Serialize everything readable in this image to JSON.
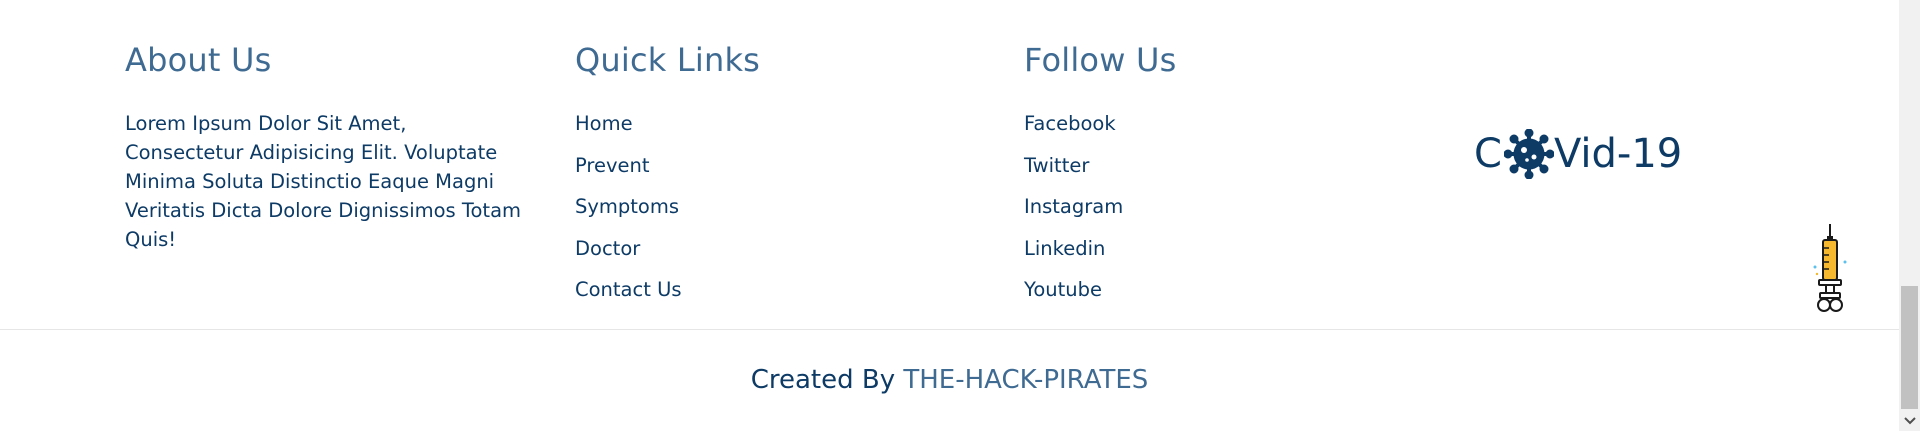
{
  "about": {
    "title": "About Us",
    "text": "Lorem Ipsum Dolor Sit Amet, Consectetur Adipisicing Elit. Voluptate Minima Soluta Distinctio Eaque Magni Veritatis Dicta Dolore Dignissimos Totam Quis!"
  },
  "quick_links": {
    "title": "Quick Links",
    "items": [
      "Home",
      "Prevent",
      "Symptoms",
      "Doctor",
      "Contact Us"
    ]
  },
  "follow": {
    "title": "Follow Us",
    "items": [
      "Facebook",
      "Twitter",
      "Instagram",
      "Linkedin",
      "Youtube"
    ]
  },
  "logo": {
    "prefix": "C",
    "suffix": "Vid-19",
    "icon": "virus-icon",
    "color": "#0d3b66"
  },
  "scroll_top": {
    "icon": "syringe-icon"
  },
  "credit": {
    "prefix": "Created By ",
    "brand": "THE-HACK-PIRATES"
  },
  "colors": {
    "heading": "#3f6b93",
    "text": "#0d3b66",
    "syringe": "#f5b82e"
  }
}
